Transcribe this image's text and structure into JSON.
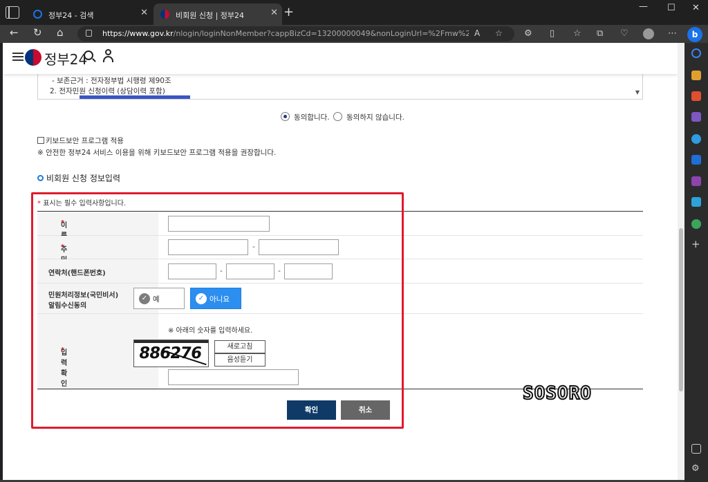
{
  "browser": {
    "tabs": [
      {
        "title": "정부24 - 검색",
        "favicon_color": "#1a73e8"
      },
      {
        "title": "비회원 신청 | 정부24",
        "favicon_color": "#c60c30"
      }
    ],
    "url_domain": "https://www.gov.kr",
    "url_rest": "/nlogin/loginNonMember?cappBizCd=13200000049&nonLoginUrl=%2Fmw%2FAA040Off...",
    "sidebar_icon_colors": [
      "#3b82f6",
      "#e0a030",
      "#e05030",
      "#7e57c2",
      "#2f9be0",
      "#1e6fd8",
      "#8e44ad",
      "#2ea2d8",
      "#3ba55c"
    ]
  },
  "site": {
    "logo_text": "정부24"
  },
  "terms": {
    "line1": "- 보존근거 : 전자정부법 시행령 제90조",
    "line2": "2. 전자민원 신청이력 (상담이력 포함)"
  },
  "consent": {
    "agree": "동의합니다.",
    "disagree": "동의하지 않습니다."
  },
  "keyboard": {
    "label": "키보드보안 프로그램 적용",
    "notice": "※ 안전한 정부24 서비스 이용을 위해 키보드보안 프로그램 적용을 권장합니다."
  },
  "section": {
    "title": "비회원 신청 정보입력",
    "required_star": "*",
    "required_note": "표시는 필수 입력사항입니다."
  },
  "form": {
    "name_label": "이름",
    "rrn_label": "주민등록번호",
    "rrn_sep": "-",
    "phone_label": "연락처(핸드폰번호)",
    "phone_sep": "-",
    "notify_label_1": "민원처리정보(국민비서)",
    "notify_label_2": "알림수신동의",
    "yes": "예",
    "no": "아니요",
    "captcha_label": "입력확인",
    "captcha_hint": "※ 아래의 숫자를 입력하세요.",
    "captcha_value": "886276",
    "refresh": "새로고침",
    "audio": "음성듣기"
  },
  "actions": {
    "confirm": "확인",
    "cancel": "취소"
  },
  "watermark": "SOSORO"
}
